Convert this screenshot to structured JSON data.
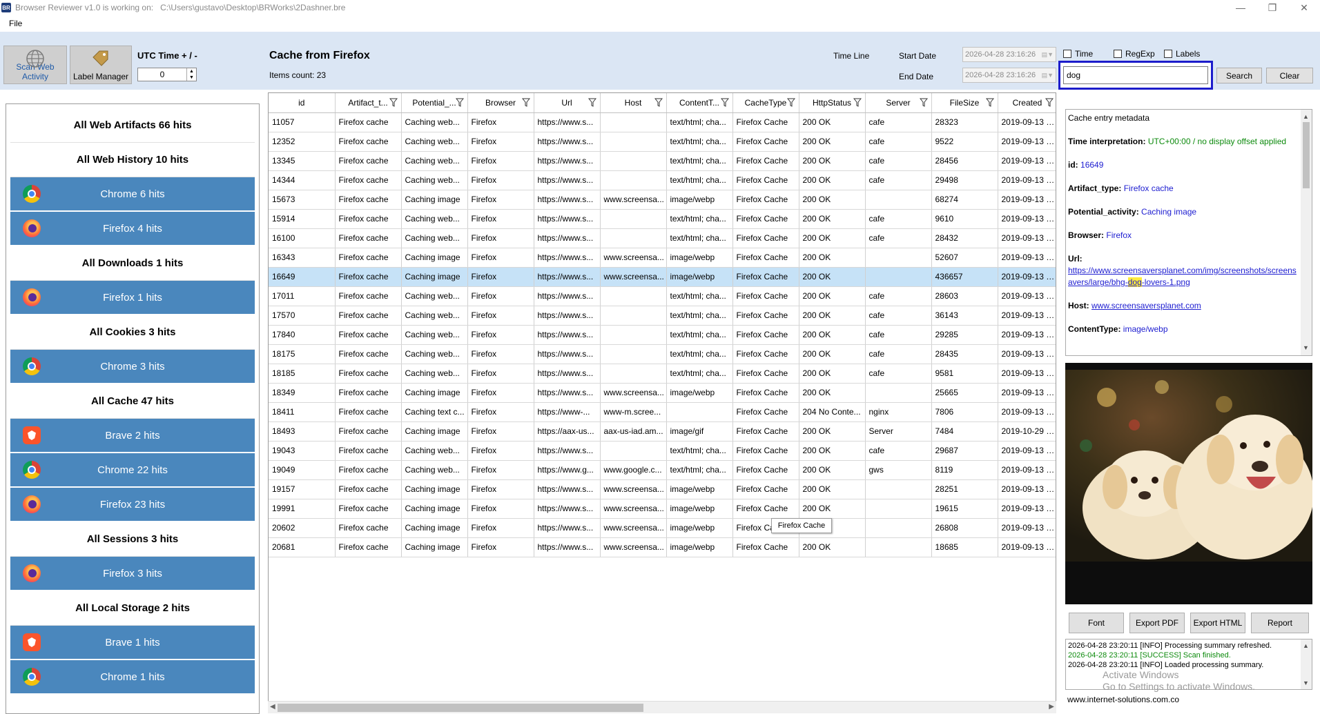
{
  "titlebar": {
    "logo": "BR",
    "title": "Browser Reviewer v1.0 is working on:",
    "path": "C:\\Users\\gustavo\\Desktop\\BRWorks\\2Dashner.bre"
  },
  "menu": {
    "file": "File"
  },
  "toolbar": {
    "scan_label_1": "Scan Web",
    "scan_label_2": "Activity",
    "label_manager": "Label Manager",
    "utc_label": "UTC Time + / -",
    "utc_value": "0",
    "title": "Cache from Firefox",
    "items_count": "Items count: 23",
    "timeline": "Time Line",
    "start_date_label": "Start Date",
    "end_date_label": "End Date",
    "start_date": "2026-04-28 23:16:26",
    "end_date": "2026-04-28 23:16:26",
    "chk_time": "Time",
    "chk_regexp": "RegExp",
    "chk_labels": "Labels",
    "search_value": "dog",
    "search_button": "Search",
    "clear_button": "Clear"
  },
  "sidebar": {
    "all_web_artifacts": "All Web Artifacts 66 hits",
    "all_web_history": "All Web History 10 hits",
    "history_chrome": "Chrome 6 hits",
    "history_firefox": "Firefox 4 hits",
    "all_downloads": "All Downloads 1 hits",
    "downloads_firefox": "Firefox 1 hits",
    "all_cookies": "All Cookies 3 hits",
    "cookies_chrome": "Chrome 3 hits",
    "all_cache": "All Cache 47 hits",
    "cache_brave": "Brave 2 hits",
    "cache_chrome": "Chrome 22 hits",
    "cache_firefox": "Firefox 23 hits",
    "all_sessions": "All Sessions 3 hits",
    "sessions_firefox": "Firefox 3 hits",
    "all_local_storage": "All Local Storage 2 hits",
    "ls_brave": "Brave 1 hits",
    "ls_chrome": "Chrome 1 hits"
  },
  "table": {
    "headers": [
      "id",
      "Artifact_t...",
      "Potential_...",
      "Browser",
      "Url",
      "Host",
      "ContentT...",
      "CacheType",
      "HttpStatus",
      "Server",
      "FileSize",
      "Created"
    ],
    "rows": [
      [
        "11057",
        "Firefox cache",
        "Caching web...",
        "Firefox",
        "https://www.s...",
        "",
        "text/html; cha...",
        "Firefox Cache",
        "200 OK",
        "cafe",
        "28323",
        "2019-09-13 1..."
      ],
      [
        "12352",
        "Firefox cache",
        "Caching web...",
        "Firefox",
        "https://www.s...",
        "",
        "text/html; cha...",
        "Firefox Cache",
        "200 OK",
        "cafe",
        "9522",
        "2019-09-13 1..."
      ],
      [
        "13345",
        "Firefox cache",
        "Caching web...",
        "Firefox",
        "https://www.s...",
        "",
        "text/html; cha...",
        "Firefox Cache",
        "200 OK",
        "cafe",
        "28456",
        "2019-09-13 1..."
      ],
      [
        "14344",
        "Firefox cache",
        "Caching web...",
        "Firefox",
        "https://www.s...",
        "",
        "text/html; cha...",
        "Firefox Cache",
        "200 OK",
        "cafe",
        "29498",
        "2019-09-13 1..."
      ],
      [
        "15673",
        "Firefox cache",
        "Caching image",
        "Firefox",
        "https://www.s...",
        "www.screensa...",
        "image/webp",
        "Firefox Cache",
        "200 OK",
        "",
        "68274",
        "2019-09-13 1..."
      ],
      [
        "15914",
        "Firefox cache",
        "Caching web...",
        "Firefox",
        "https://www.s...",
        "",
        "text/html; cha...",
        "Firefox Cache",
        "200 OK",
        "cafe",
        "9610",
        "2019-09-13 1..."
      ],
      [
        "16100",
        "Firefox cache",
        "Caching web...",
        "Firefox",
        "https://www.s...",
        "",
        "text/html; cha...",
        "Firefox Cache",
        "200 OK",
        "cafe",
        "28432",
        "2019-09-13 1..."
      ],
      [
        "16343",
        "Firefox cache",
        "Caching image",
        "Firefox",
        "https://www.s...",
        "www.screensa...",
        "image/webp",
        "Firefox Cache",
        "200 OK",
        "",
        "52607",
        "2019-09-13 1..."
      ],
      [
        "16649",
        "Firefox cache",
        "Caching image",
        "Firefox",
        "https://www.s...",
        "www.screensa...",
        "image/webp",
        "Firefox Cache",
        "200 OK",
        "",
        "436657",
        "2019-09-13 1..."
      ],
      [
        "17011",
        "Firefox cache",
        "Caching web...",
        "Firefox",
        "https://www.s...",
        "",
        "text/html; cha...",
        "Firefox Cache",
        "200 OK",
        "cafe",
        "28603",
        "2019-09-13 1..."
      ],
      [
        "17570",
        "Firefox cache",
        "Caching web...",
        "Firefox",
        "https://www.s...",
        "",
        "text/html; cha...",
        "Firefox Cache",
        "200 OK",
        "cafe",
        "36143",
        "2019-09-13 1..."
      ],
      [
        "17840",
        "Firefox cache",
        "Caching web...",
        "Firefox",
        "https://www.s...",
        "",
        "text/html; cha...",
        "Firefox Cache",
        "200 OK",
        "cafe",
        "29285",
        "2019-09-13 1..."
      ],
      [
        "18175",
        "Firefox cache",
        "Caching web...",
        "Firefox",
        "https://www.s...",
        "",
        "text/html; cha...",
        "Firefox Cache",
        "200 OK",
        "cafe",
        "28435",
        "2019-09-13 1..."
      ],
      [
        "18185",
        "Firefox cache",
        "Caching web...",
        "Firefox",
        "https://www.s...",
        "",
        "text/html; cha...",
        "Firefox Cache",
        "200 OK",
        "cafe",
        "9581",
        "2019-09-13 1..."
      ],
      [
        "18349",
        "Firefox cache",
        "Caching image",
        "Firefox",
        "https://www.s...",
        "www.screensa...",
        "image/webp",
        "Firefox Cache",
        "200 OK",
        "",
        "25665",
        "2019-09-13 1..."
      ],
      [
        "18411",
        "Firefox cache",
        "Caching text c...",
        "Firefox",
        "https://www-...",
        "www-m.scree...",
        "",
        "Firefox Cache",
        "204 No Conte...",
        "nginx",
        "7806",
        "2019-09-13 1..."
      ],
      [
        "18493",
        "Firefox cache",
        "Caching image",
        "Firefox",
        "https://aax-us...",
        "aax-us-iad.am...",
        "image/gif",
        "Firefox Cache",
        "200 OK",
        "Server",
        "7484",
        "2019-10-29 2..."
      ],
      [
        "19043",
        "Firefox cache",
        "Caching web...",
        "Firefox",
        "https://www.s...",
        "",
        "text/html; cha...",
        "Firefox Cache",
        "200 OK",
        "cafe",
        "29687",
        "2019-09-13 1..."
      ],
      [
        "19049",
        "Firefox cache",
        "Caching web...",
        "Firefox",
        "https://www.g...",
        "www.google.c...",
        "text/html; cha...",
        "Firefox Cache",
        "200 OK",
        "gws",
        "8119",
        "2019-09-13 1..."
      ],
      [
        "19157",
        "Firefox cache",
        "Caching image",
        "Firefox",
        "https://www.s...",
        "www.screensa...",
        "image/webp",
        "Firefox Cache",
        "200 OK",
        "",
        "28251",
        "2019-09-13 1..."
      ],
      [
        "19991",
        "Firefox cache",
        "Caching image",
        "Firefox",
        "https://www.s...",
        "www.screensa...",
        "image/webp",
        "Firefox Cache",
        "200 OK",
        "",
        "19615",
        "2019-09-13 1..."
      ],
      [
        "20602",
        "Firefox cache",
        "Caching image",
        "Firefox",
        "https://www.s...",
        "www.screensa...",
        "image/webp",
        "Firefox Ca",
        "",
        "",
        "26808",
        "2019-09-13 1..."
      ],
      [
        "20681",
        "Firefox cache",
        "Caching image",
        "Firefox",
        "https://www.s...",
        "www.screensa...",
        "image/webp",
        "Firefox Cache",
        "200 OK",
        "",
        "18685",
        "2019-09-13 1..."
      ]
    ],
    "selected_index": 8,
    "tooltip": "Firefox Cache"
  },
  "meta": {
    "heading": "Cache entry metadata",
    "time_key": "Time interpretation:",
    "time_val": "UTC+00:00 / no display offset applied",
    "id_key": "id:",
    "id_val": "16649",
    "artifact_key": "Artifact_type:",
    "artifact_val": "Firefox cache",
    "potential_key": "Potential_activity:",
    "potential_val": "Caching image",
    "browser_key": "Browser:",
    "browser_val": "Firefox",
    "url_key": "Url:",
    "url_pre": "https://www.screensaversplanet.com/img/screenshots/screensavers/large/bhg-",
    "url_hl": "dog",
    "url_post": "-lovers-1.png",
    "host_key": "Host:",
    "host_val": "www.screensaversplanet.com",
    "ctype_key": "ContentType:",
    "ctype_val": "image/webp"
  },
  "buttons": {
    "font": "Font",
    "export_pdf": "Export PDF",
    "export_html": "Export HTML",
    "report": "Report"
  },
  "log": {
    "line1": "2026-04-28 23:20:11 [INFO] Processing summary refreshed.",
    "line2": "2026-04-28 23:20:11 [SUCCESS] Scan finished.",
    "line3": "2026-04-28 23:20:11 [INFO] Loaded processing summary."
  },
  "watermark": {
    "line1": "Activate Windows",
    "line2": "Go to Settings to activate Windows."
  },
  "footer": {
    "url": "www.internet-solutions.com.co"
  },
  "colors": {
    "accent": "#4a87bd",
    "toolbar_bg": "#dbe6f4",
    "selection": "#c6e2f7",
    "search_highlight": "#1c1ccb",
    "link": "#1c1cd0",
    "success": "#0c8a0c"
  }
}
